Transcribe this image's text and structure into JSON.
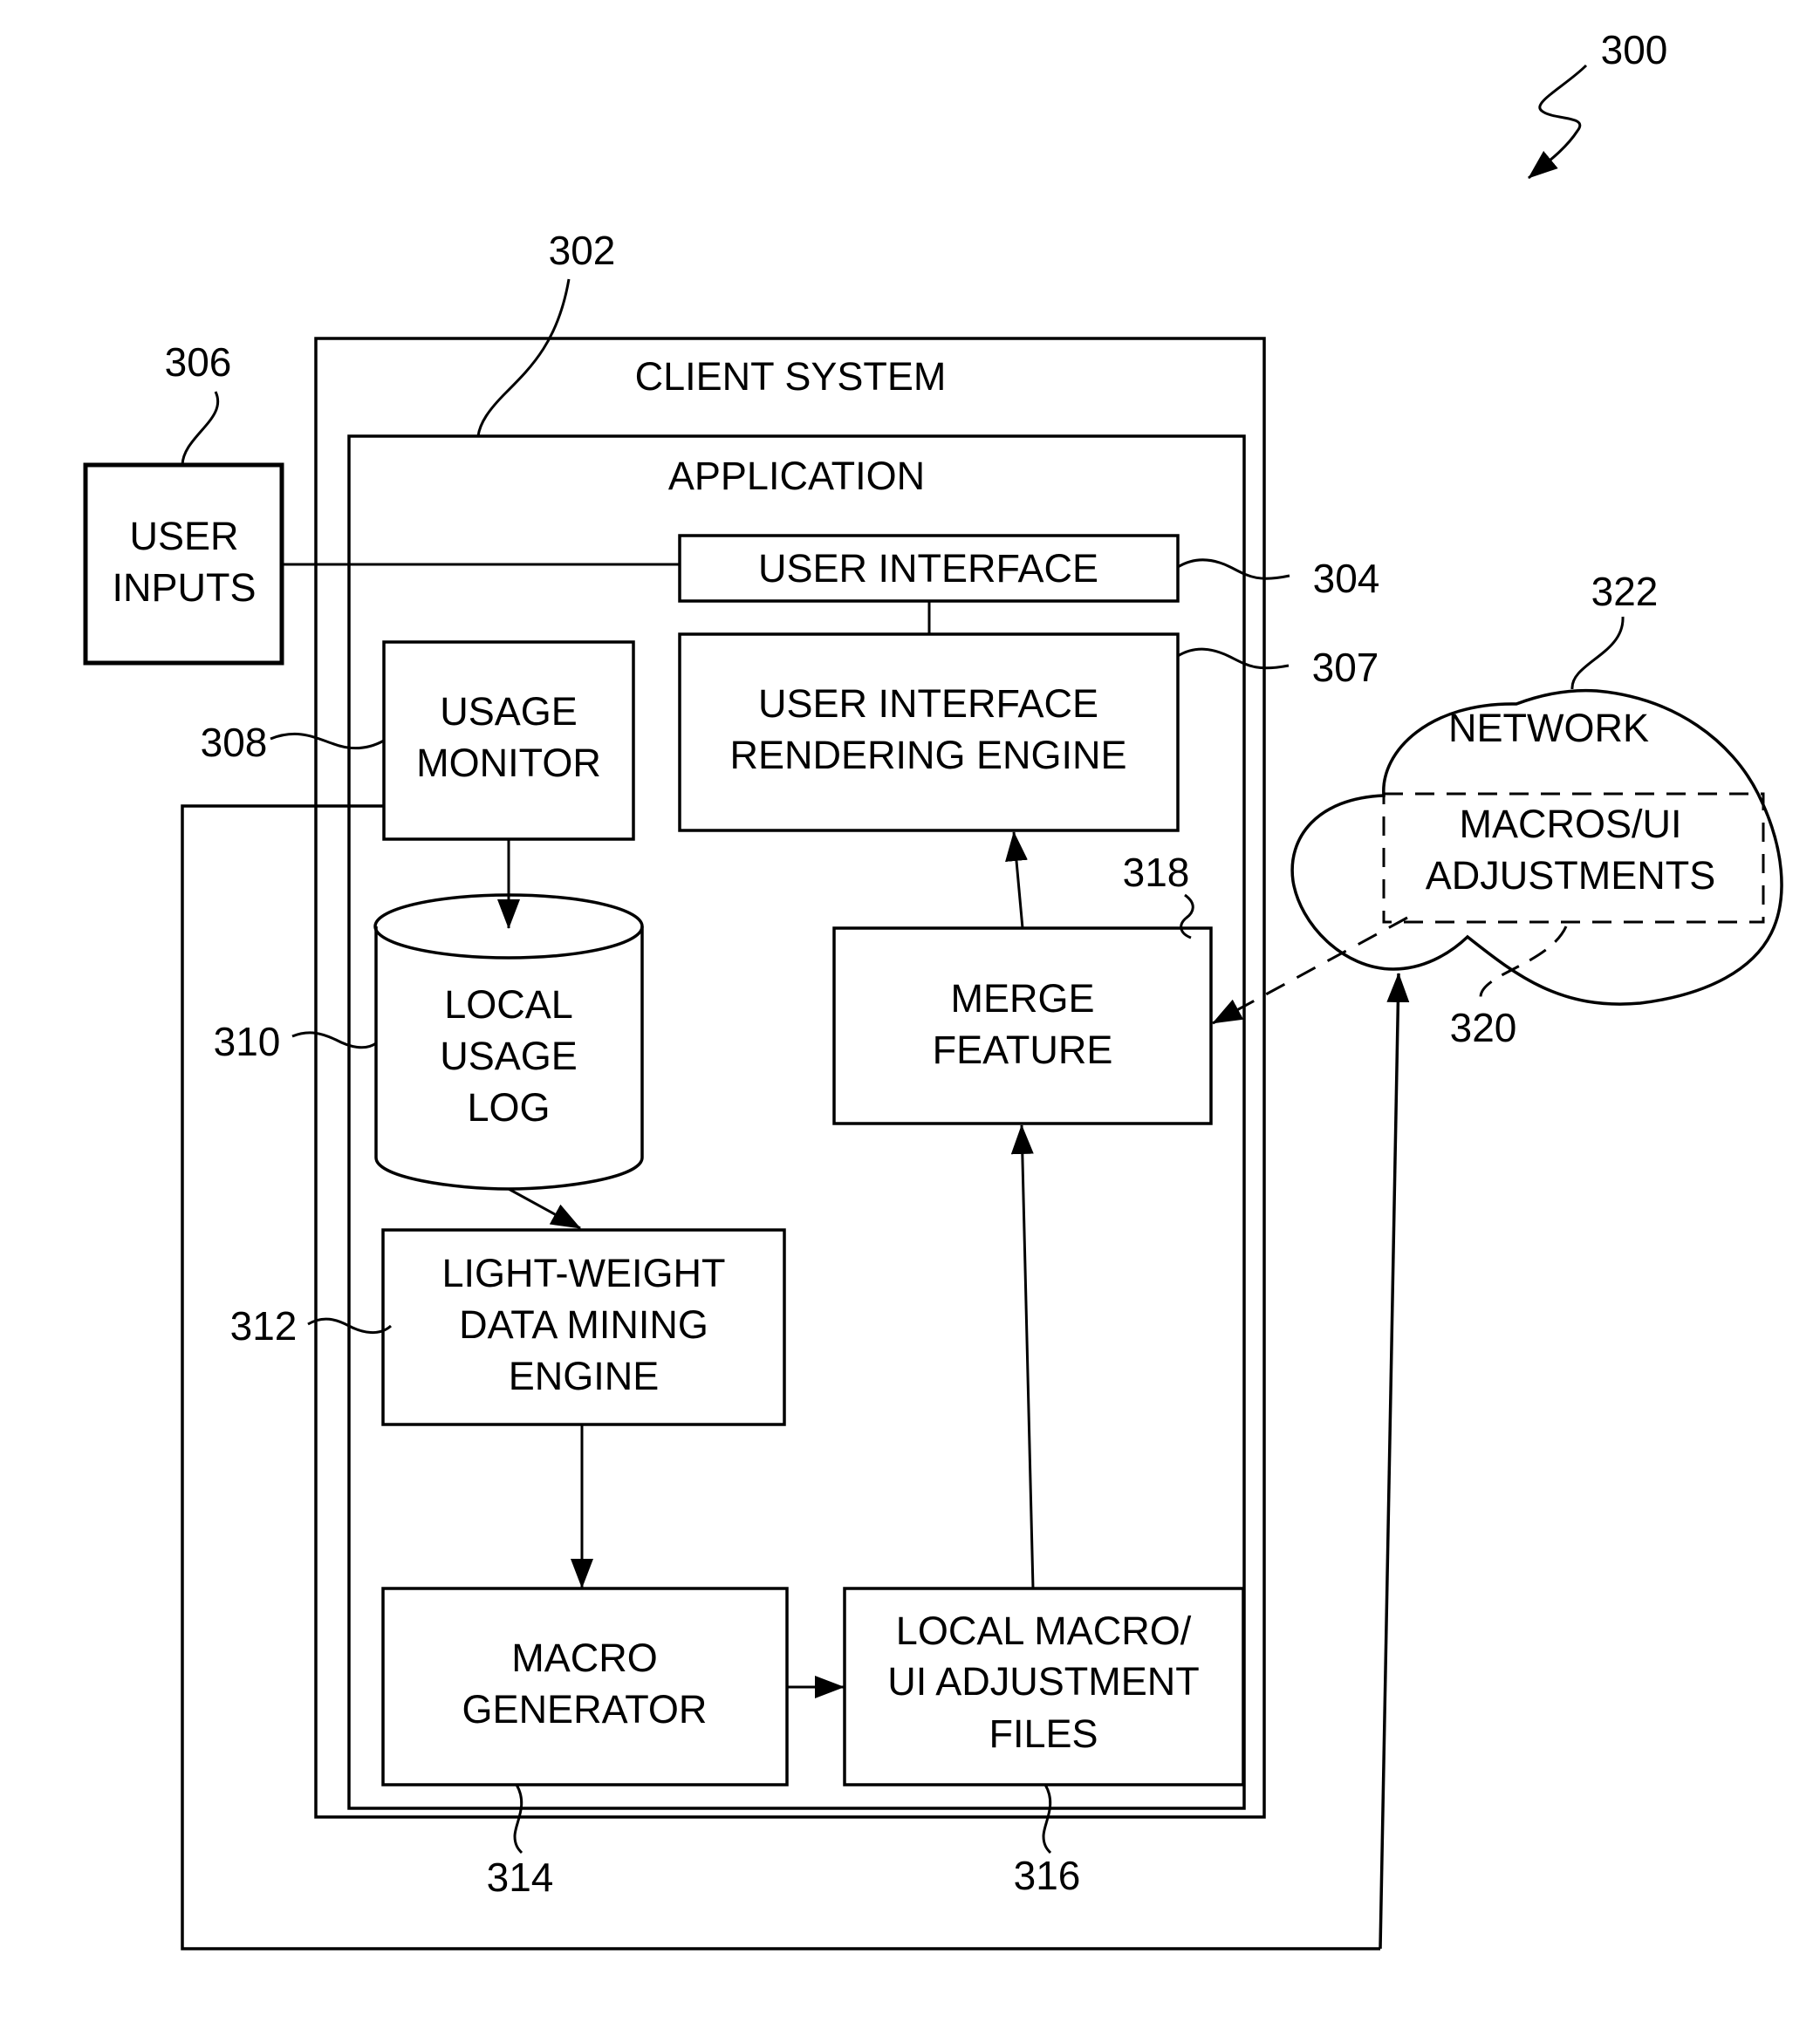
{
  "figure": {
    "ref": "300",
    "colors": {
      "ink": "#000000",
      "paper": "#ffffff"
    }
  },
  "client_system": {
    "label": "CLIENT SYSTEM"
  },
  "application": {
    "label": "APPLICATION",
    "ref": "302"
  },
  "user_inputs": {
    "lines": [
      "USER",
      "INPUTS"
    ],
    "ref": "306"
  },
  "user_interface": {
    "label": "USER INTERFACE",
    "ref": "304"
  },
  "ui_rendering_engine": {
    "lines": [
      "USER INTERFACE",
      "RENDERING ENGINE"
    ],
    "ref": "307"
  },
  "usage_monitor": {
    "lines": [
      "USAGE",
      "MONITOR"
    ],
    "ref": "308"
  },
  "local_usage_log": {
    "lines": [
      "LOCAL",
      "USAGE",
      "LOG"
    ],
    "ref": "310"
  },
  "data_mining_engine": {
    "lines": [
      "LIGHT-WEIGHT",
      "DATA MINING",
      "ENGINE"
    ],
    "ref": "312"
  },
  "macro_generator": {
    "lines": [
      "MACRO",
      "GENERATOR"
    ],
    "ref": "314"
  },
  "local_macro_files": {
    "lines": [
      "LOCAL MACRO/",
      "UI ADJUSTMENT",
      "FILES"
    ],
    "ref": "316"
  },
  "merge_feature": {
    "lines": [
      "MERGE",
      "FEATURE"
    ],
    "ref": "318"
  },
  "network": {
    "label": "NETWORK",
    "ref": "322"
  },
  "macros_ui_adjustments": {
    "lines": [
      "MACROS/UI",
      "ADJUSTMENTS"
    ],
    "ref": "320"
  }
}
